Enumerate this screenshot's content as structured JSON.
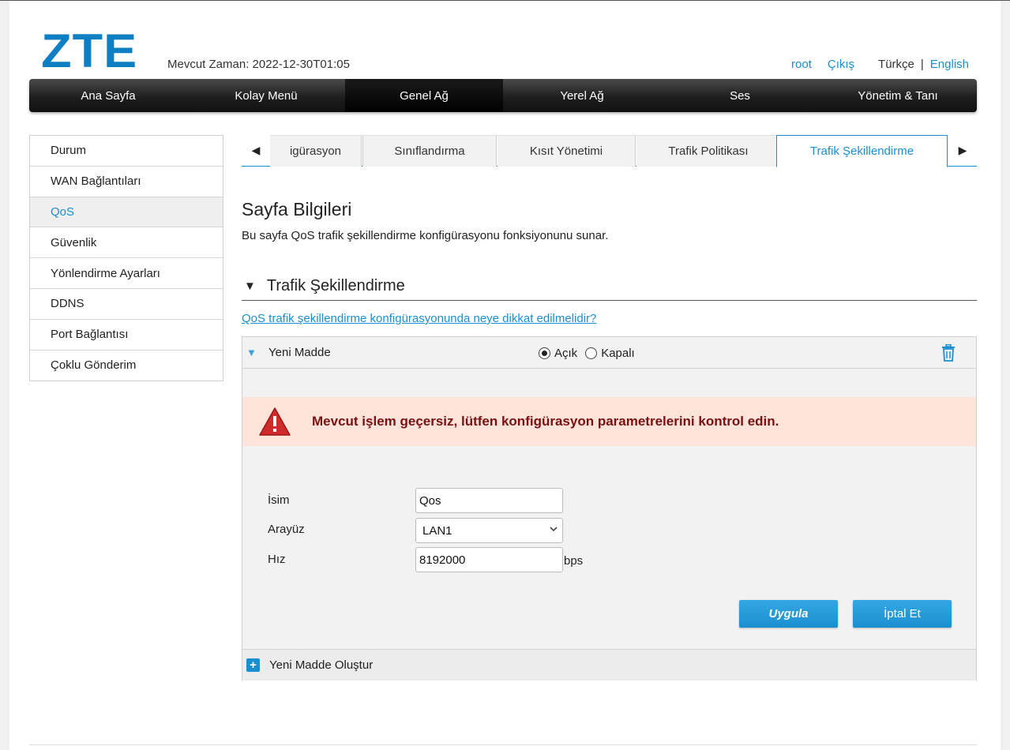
{
  "header": {
    "logo": "ZTE",
    "current_time": "Mevcut Zaman: 2022-12-30T01:05",
    "user": "root",
    "logout": "Çıkış",
    "lang_current": "Türkçe",
    "lang_separator": "|",
    "lang_other": "English"
  },
  "nav": {
    "items": [
      "Ana Sayfa",
      "Kolay Menü",
      "Genel Ağ",
      "Yerel Ağ",
      "Ses",
      "Yönetim & Tanı"
    ],
    "active": "Genel Ağ"
  },
  "sidebar": {
    "items": [
      "Durum",
      "WAN Bağlantıları",
      "QoS",
      "Güvenlik",
      "Yönlendirme Ayarları",
      "DDNS",
      "Port Bağlantısı",
      "Çoklu Gönderim"
    ],
    "active": "QoS"
  },
  "tabs": {
    "items": [
      "igürasyon",
      "Sınıflandırma",
      "Kısıt Yönetimi",
      "Trafik Politikası",
      "Trafik Şekillendirme"
    ],
    "active": "Trafik Şekillendirme",
    "left_arrow": "◀",
    "right_arrow": "▶"
  },
  "page": {
    "title": "Sayfa Bilgileri",
    "description": "Bu sayfa QoS trafik şekillendirme konfigürasyonu fonksiyonunu sunar.",
    "section_title": "Trafik Şekillendirme",
    "help_link": "QoS trafik şekillendirme konfigürasyonunda neye dikkat edilmelidir?"
  },
  "entry": {
    "title": "Yeni Madde",
    "radio_on": "Açık",
    "radio_off": "Kapalı",
    "selected": "Açık",
    "error_message": "Mevcut işlem geçersiz, lütfen konfigürasyon parametrelerini kontrol edin.",
    "fields": {
      "name_label": "İsim",
      "name_value": "Qos",
      "interface_label": "Arayüz",
      "interface_value": "LAN1",
      "rate_label": "Hız",
      "rate_value": "8192000",
      "rate_unit": "bps"
    },
    "apply_button": "Uygula",
    "cancel_button": "İptal  Et",
    "create_new": "Yeni Madde Oluştur"
  },
  "colors": {
    "accent": "#1a8fd0",
    "error_bg": "#fde3da",
    "error_text": "#7a1010",
    "nav_bg": "#1e1e1e"
  },
  "icons": {
    "trash": "trash-icon",
    "warning": "warning-triangle-icon",
    "expand": "triangle-down-icon",
    "add": "plus-icon"
  }
}
